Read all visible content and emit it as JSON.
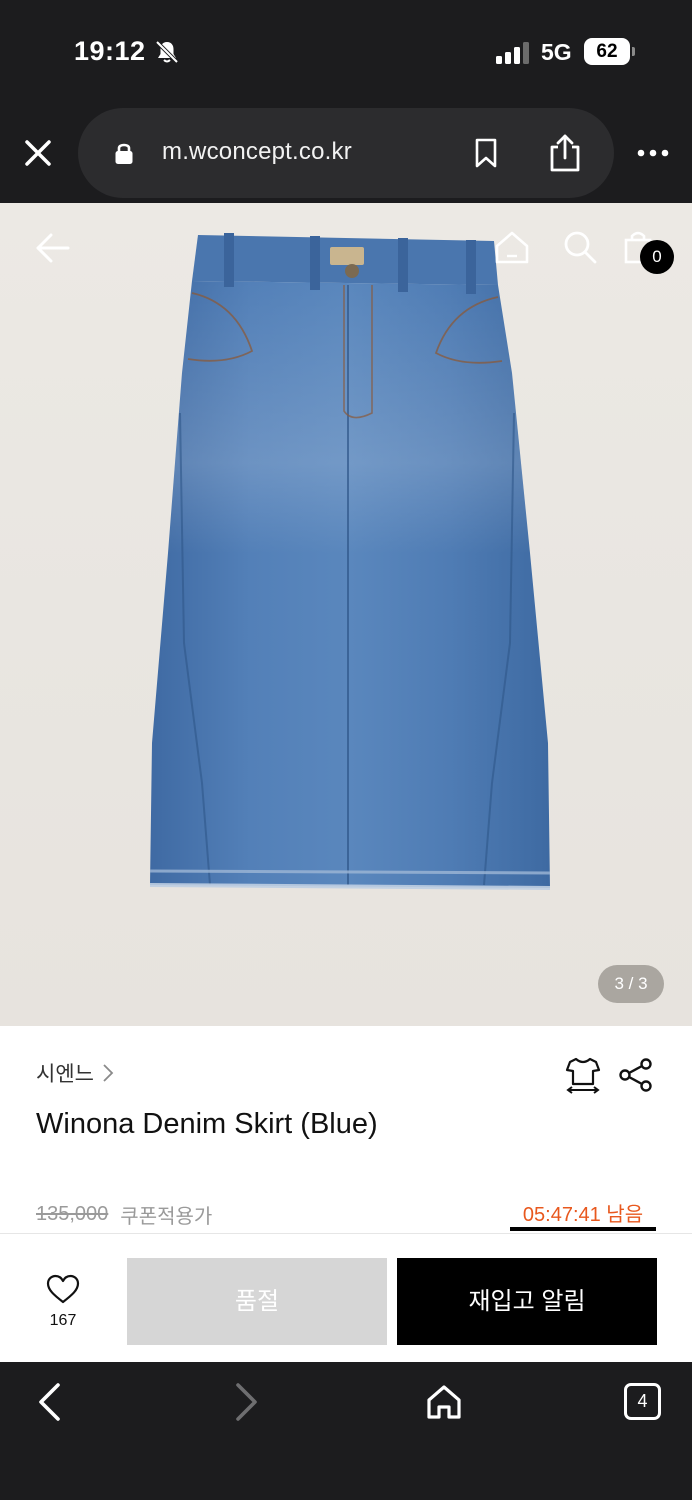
{
  "status_bar": {
    "time": "19:12",
    "network": "5G",
    "battery": "62"
  },
  "browser": {
    "url": "m.wconcept.co.kr",
    "tab_count": "4"
  },
  "hero": {
    "cart_count": "0",
    "slide_counter": "3 / 3"
  },
  "product": {
    "brand": "시엔느",
    "title": "Winona Denim Skirt (Blue)",
    "original_price": "135,000",
    "coupon_label": "쿠폰적용가",
    "timer": "05:47:41 남음"
  },
  "actions": {
    "like_count": "167",
    "soldout_label": "품절",
    "restock_label": "재입고 알림"
  },
  "colors": {
    "timer_accent": "#e8581e",
    "soldout_bg": "#d6d6d6",
    "restock_bg": "#000000",
    "browser_chrome": "#1c1c1e"
  }
}
